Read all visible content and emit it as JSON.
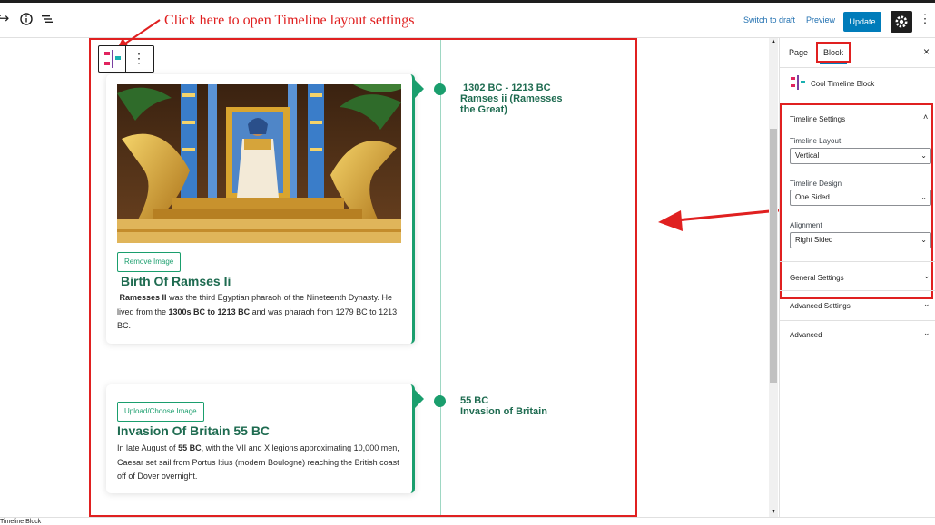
{
  "topbar": {
    "switch_to_draft": "Switch to draft",
    "preview": "Preview",
    "update": "Update",
    "undo_icon": "redo-arrow-icon",
    "info_icon": "info-icon",
    "outline_icon": "list-outline-icon"
  },
  "annotations": {
    "top_text": "Click here to open Timeline layout settings",
    "color": "#e02020"
  },
  "timeline": {
    "accent": "#1a9e6d",
    "items": [
      {
        "date_line1": "1302 BC - 1213 BC",
        "date_line2": "Ramses ii (Ramesses",
        "date_line3": "the Great)",
        "button": "Remove Image",
        "title": "Birth Of Ramses Ii",
        "desc_bold1": "Ramesses II",
        "desc_part1": " was the third Egyptian pharaoh of the Nineteenth Dynasty. He lived from the ",
        "desc_bold2": "1300s BC to 1213 BC",
        "desc_part2": " and was pharaoh from 1279 BC to 1213 BC."
      },
      {
        "date_line1": "55 BC",
        "date_line2": "Invasion of Britain",
        "button": "Upload/Choose Image",
        "title": "Invasion Of Britain 55 BC",
        "desc_part0": " In late August of ",
        "desc_bold1": "55 BC",
        "desc_part1": ", with the VII and X legions approximating 10,000 men, Caesar set sail from Portus Itius (modern Boulogne) reaching the British coast off of Dover overnight."
      }
    ]
  },
  "sidebar": {
    "tab_page": "Page",
    "tab_block": "Block",
    "close": "×",
    "block_name": "Cool Timeline Block",
    "timeline_settings": {
      "title": "Timeline Settings",
      "layout_label": "Timeline Layout",
      "layout_value": "Vertical",
      "design_label": "Timeline Design",
      "design_value": "One Sided",
      "alignment_label": "Alignment",
      "alignment_value": "Right Sided"
    },
    "general_settings": "General Settings",
    "advanced_settings": "Advanced Settings",
    "advanced": "Advanced"
  },
  "footer": {
    "breadcrumb": "Timeline Block"
  }
}
